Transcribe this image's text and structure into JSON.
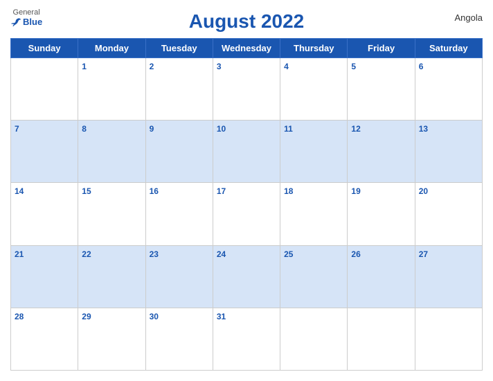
{
  "header": {
    "title": "August 2022",
    "country": "Angola",
    "logo": {
      "general": "General",
      "blue": "Blue"
    }
  },
  "weekdays": [
    "Sunday",
    "Monday",
    "Tuesday",
    "Wednesday",
    "Thursday",
    "Friday",
    "Saturday"
  ],
  "weeks": [
    [
      null,
      1,
      2,
      3,
      4,
      5,
      6
    ],
    [
      7,
      8,
      9,
      10,
      11,
      12,
      13
    ],
    [
      14,
      15,
      16,
      17,
      18,
      19,
      20
    ],
    [
      21,
      22,
      23,
      24,
      25,
      26,
      27
    ],
    [
      28,
      29,
      30,
      31,
      null,
      null,
      null
    ]
  ],
  "row_shading": [
    false,
    true,
    false,
    true,
    false
  ]
}
